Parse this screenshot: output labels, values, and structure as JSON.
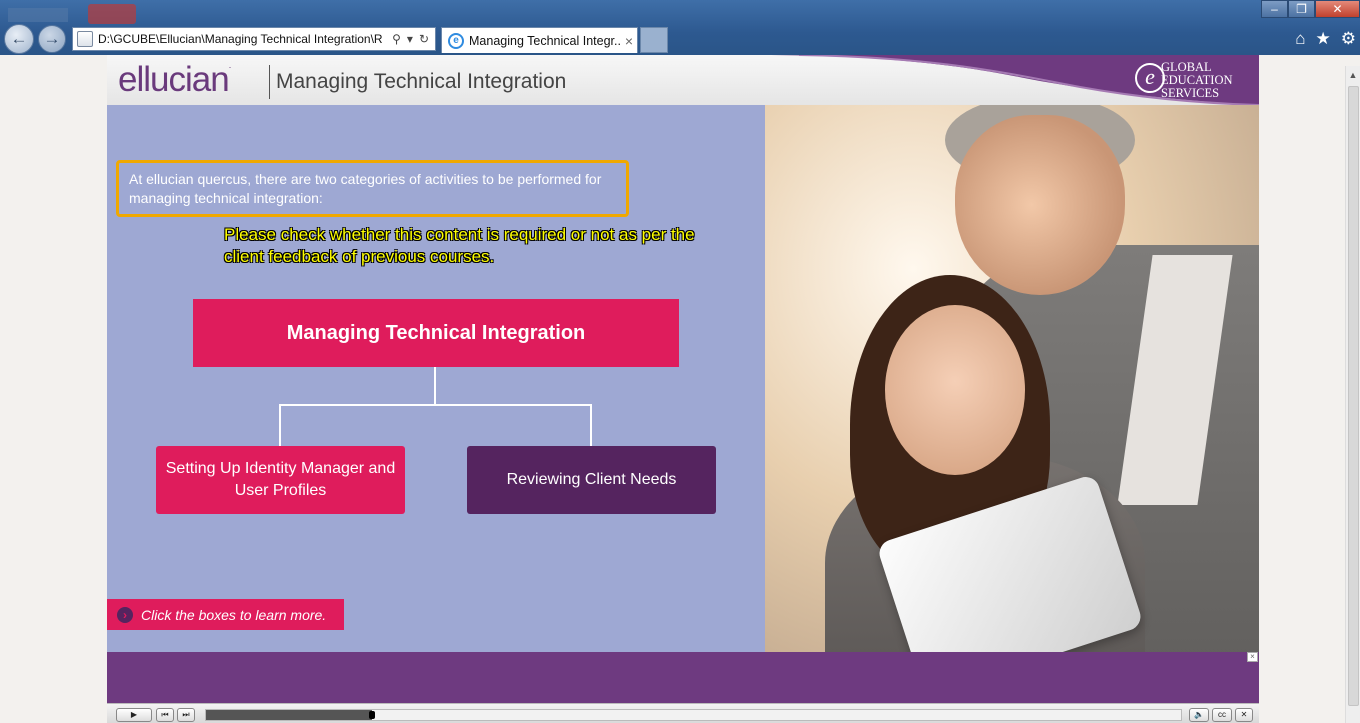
{
  "browser": {
    "address": "D:\\GCUBE\\Ellucian\\Managing Technical Integration\\R",
    "tab_title": "Managing Technical Integr...",
    "tab_close": "×",
    "search_glyph": "⚲",
    "dropdown_glyph": "▾",
    "refresh_glyph": "↻",
    "back_glyph": "←",
    "forward_glyph": "→",
    "home_glyph": "⌂",
    "favorites_glyph": "★",
    "tools_glyph": "⚙",
    "minimize_glyph": "‒",
    "restore_glyph": "❐",
    "close_glyph": "✕"
  },
  "header": {
    "logo": "ellucian",
    "logo_mark": ".",
    "course_title": "Managing Technical Integration",
    "brand_letter": "e",
    "brand_line1": "GLOBAL",
    "brand_line2": "EDUCATION",
    "brand_line3": "SERVICES"
  },
  "content": {
    "intro": "At ellucian quercus, there are two categories of activities to be performed for managing technical integration:",
    "reviewer_note": "Please check whether this content is required or not as per the client feedback of previous courses.",
    "main_box": "Managing Technical Integration",
    "child_1": "Setting Up Identity Manager and User Profiles",
    "child_2": "Reviewing Client Needs",
    "hint": "Click the boxes to learn more.",
    "hint_glyph": "›"
  },
  "player": {
    "progress": 0.17,
    "play_glyph": "▶",
    "prev_glyph": "⏮",
    "next_glyph": "⏭",
    "volume_glyph": "🔈",
    "cc_label": "cc",
    "close_glyph": "✕"
  },
  "colors": {
    "accent_pink": "#df1c5c",
    "accent_purple": "#55245f",
    "panel_lavender": "#9ea8d3",
    "footer_purple": "#6e3a80",
    "highlight_orange": "#f0a800",
    "note_yellow": "#ffff00"
  }
}
